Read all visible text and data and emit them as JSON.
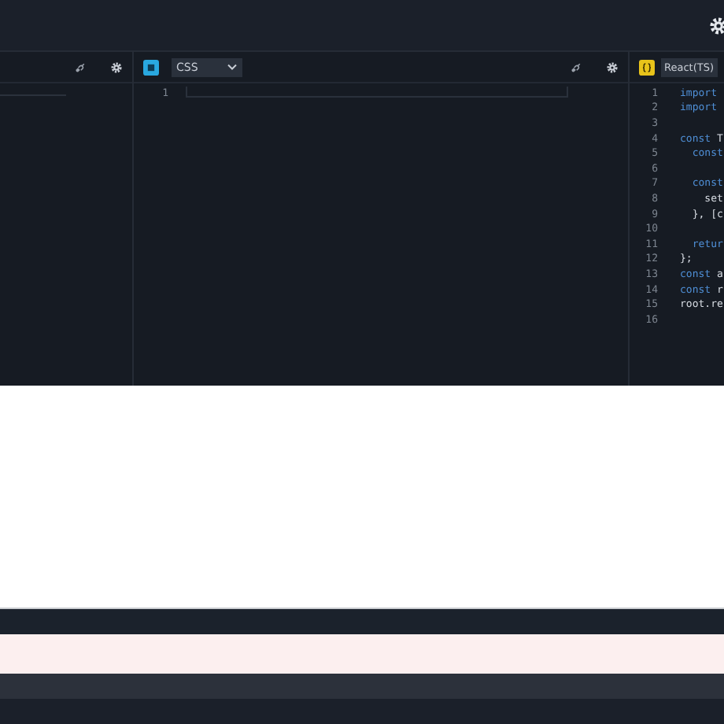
{
  "editors": [
    {
      "kind": "blank"
    },
    {
      "kind": "editor",
      "color": "#29a8e0",
      "language": "CSS",
      "dropdown": true,
      "lines": [
        {
          "number": "1"
        }
      ]
    },
    {
      "kind": "editor",
      "color": "#e8c31a",
      "language": "React(TS)",
      "lines": [
        {
          "number": "1",
          "tokens": [
            {
              "text": "import",
              "kind": "keyword"
            }
          ]
        },
        {
          "number": "2",
          "tokens": [
            {
              "text": "import",
              "kind": "keyword"
            }
          ]
        },
        {
          "number": "3"
        },
        {
          "number": "4",
          "tokens": [
            {
              "text": "const",
              "kind": "keyword"
            },
            {
              "text": " T",
              "kind": "plain"
            }
          ]
        },
        {
          "number": "5",
          "tokens": [
            {
              "text": "  const",
              "kind": "keyword"
            }
          ]
        },
        {
          "number": "6"
        },
        {
          "number": "7",
          "tokens": [
            {
              "text": "  const",
              "kind": "keyword"
            }
          ]
        },
        {
          "number": "8",
          "tokens": [
            {
              "text": "    set",
              "kind": "plain"
            }
          ]
        },
        {
          "number": "9",
          "tokens": [
            {
              "text": "  }, [c",
              "kind": "plain"
            }
          ]
        },
        {
          "number": "10"
        },
        {
          "number": "11",
          "tokens": [
            {
              "text": "  retur",
              "kind": "keyword"
            }
          ]
        },
        {
          "number": "12",
          "tokens": [
            {
              "text": "};",
              "kind": "plain"
            }
          ]
        },
        {
          "number": "13",
          "tokens": [
            {
              "text": "const",
              "kind": "keyword"
            },
            {
              "text": " a",
              "kind": "plain"
            }
          ]
        },
        {
          "number": "14",
          "tokens": [
            {
              "text": "const",
              "kind": "keyword"
            },
            {
              "text": " r",
              "kind": "plain"
            }
          ]
        },
        {
          "number": "15",
          "tokens": [
            {
              "text": "root.re",
              "kind": "plain"
            }
          ]
        },
        {
          "number": "16"
        }
      ]
    }
  ]
}
